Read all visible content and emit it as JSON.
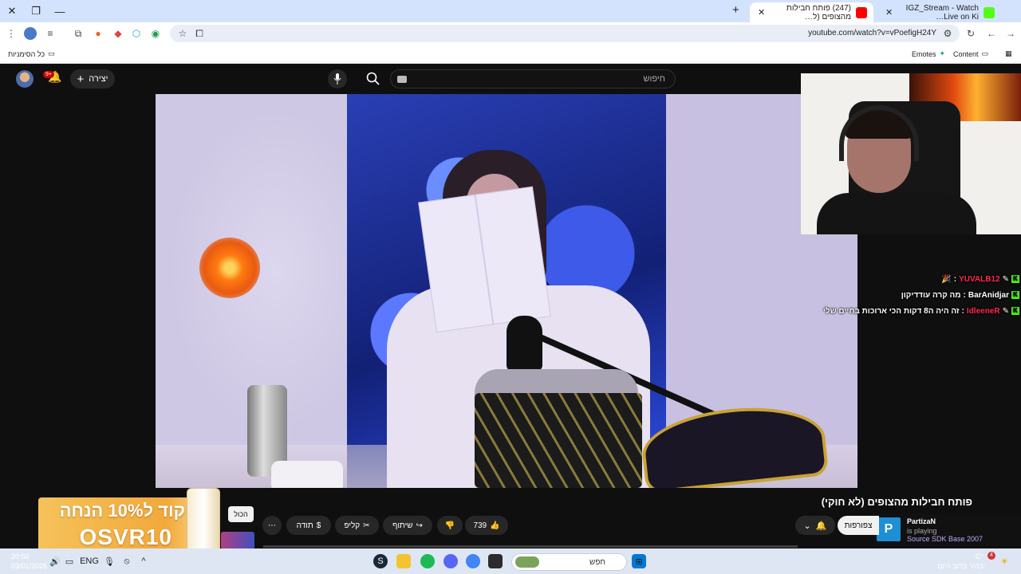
{
  "browser": {
    "tabs": [
      {
        "title": "(247) פותח חבילות מהצופים (ל…",
        "active": true
      },
      {
        "title": "IGZ_Stream - Watch Live on Ki…",
        "active": false
      }
    ],
    "url": "youtube.com/watch?v=vPoefigH24Y",
    "bookmarks": {
      "all": "כל הסימניות",
      "emotes": "Emotes",
      "content": "Content"
    }
  },
  "youtube": {
    "search_placeholder": "חיפוש",
    "create_label": "יצירה",
    "notif_badge": "9+",
    "video_title": "פותח חבילות מהצופים (לא חוקי)",
    "subscribe_label": "צפורפות",
    "likes": "739",
    "share_label": "שיתוף",
    "clip_label": "קליפ",
    "thanks_label": "תודה",
    "all_chip": "הכול"
  },
  "chat": [
    {
      "user": "YUVALB12",
      "message": "",
      "user_color": "#ff2a4a"
    },
    {
      "user": "BarAnidjar",
      "message": "מה קרה עודדיקון",
      "user_color": "#ffffff"
    },
    {
      "user": "IdleeneR",
      "message": "זה היה ה8 דקות הכי ארוכות בחיים שלי",
      "user_color": "#ff2a4a"
    }
  ],
  "ad": {
    "line1": "קוד ל10% הנחה",
    "line2": "OSVR10"
  },
  "twitch_card": {
    "name": "PartizaN",
    "status": "is playing",
    "game": "Source SDK Base 2007"
  },
  "taskbar": {
    "time": "20:50",
    "date": "03/01/2026",
    "lang": "ENG",
    "search_placeholder": "חפש",
    "weather_temp": "°C",
    "weather_desc": "בהיר ברוב היום",
    "notif_count": "4"
  },
  "colors": {
    "accent": "#cc0000",
    "kick_green": "#53fc18"
  }
}
